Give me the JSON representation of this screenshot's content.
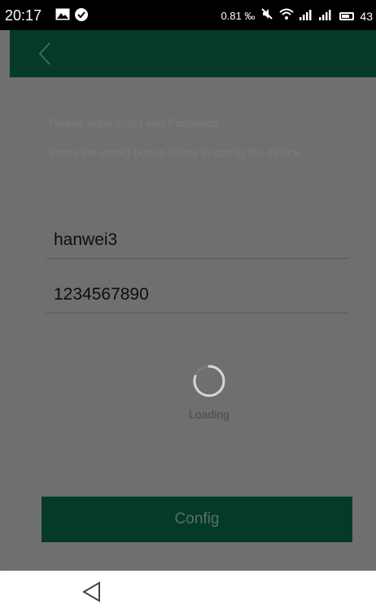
{
  "status_bar": {
    "time": "20:17",
    "image_icon": "image-icon",
    "check_icon": "check-circle-icon",
    "data_rate": "0.81 ‰",
    "mute_icon": "mute-icon",
    "wifi_icon": "wifi-icon",
    "signal_icon": "signal-icon",
    "battery_icon": "battery-icon",
    "battery_level": "43"
  },
  "header": {
    "back_icon": "chevron-left-icon",
    "color": "#053a2b"
  },
  "instructions": {
    "line1": "Please enter SSID and Password",
    "line2": "Press the config button below to config the device."
  },
  "form": {
    "ssid_value": "hanwei3",
    "password_value": "1234567890"
  },
  "loading": {
    "text": "Loading"
  },
  "config_button": {
    "label": "Config"
  },
  "nav": {
    "back_icon": "triangle-back-icon"
  },
  "colors": {
    "header": "#053a2b",
    "overlay": "#6f6f6f",
    "status_bar": "#000000"
  }
}
